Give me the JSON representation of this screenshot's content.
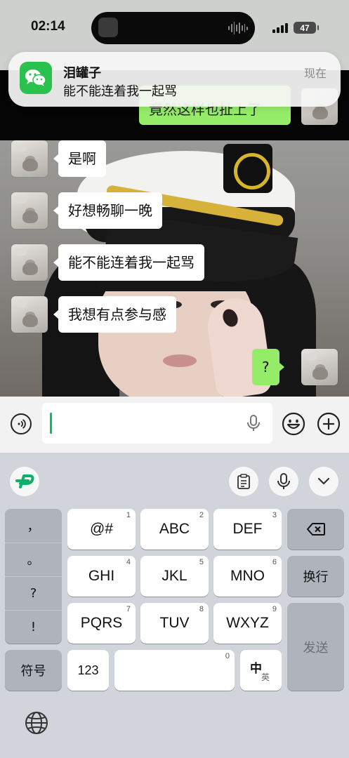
{
  "status_bar": {
    "time": "02:14",
    "battery": "47"
  },
  "notification": {
    "title": "泪罐子",
    "body": "能不能连着我一起骂",
    "time": "现在"
  },
  "chat": {
    "partial_message": "竟然这样也扯上了",
    "messages": [
      {
        "side": "left",
        "text": "是啊"
      },
      {
        "side": "left",
        "text": "好想畅聊一晚"
      },
      {
        "side": "left",
        "text": "能不能连着我一起骂"
      },
      {
        "side": "left",
        "text": "我想有点参与感"
      },
      {
        "side": "right",
        "text": "?"
      }
    ]
  },
  "input": {
    "value": ""
  },
  "keyboard": {
    "punctuation": [
      "，",
      "。",
      "?",
      "!"
    ],
    "keys": [
      {
        "label": "@#",
        "num": "1"
      },
      {
        "label": "ABC",
        "num": "2"
      },
      {
        "label": "DEF",
        "num": "3"
      },
      {
        "label": "GHI",
        "num": "4"
      },
      {
        "label": "JKL",
        "num": "5"
      },
      {
        "label": "MNO",
        "num": "6"
      },
      {
        "label": "PQRS",
        "num": "7"
      },
      {
        "label": "TUV",
        "num": "8"
      },
      {
        "label": "WXYZ",
        "num": "9"
      }
    ],
    "newline": "换行",
    "send": "发送",
    "symbols": "符号",
    "numbers": "123",
    "space_num": "0",
    "lang_main": "中",
    "lang_sub": "英"
  },
  "colors": {
    "bubble_self": "#95ec69",
    "accent": "#07c160",
    "wechat": "#2bc14f"
  }
}
